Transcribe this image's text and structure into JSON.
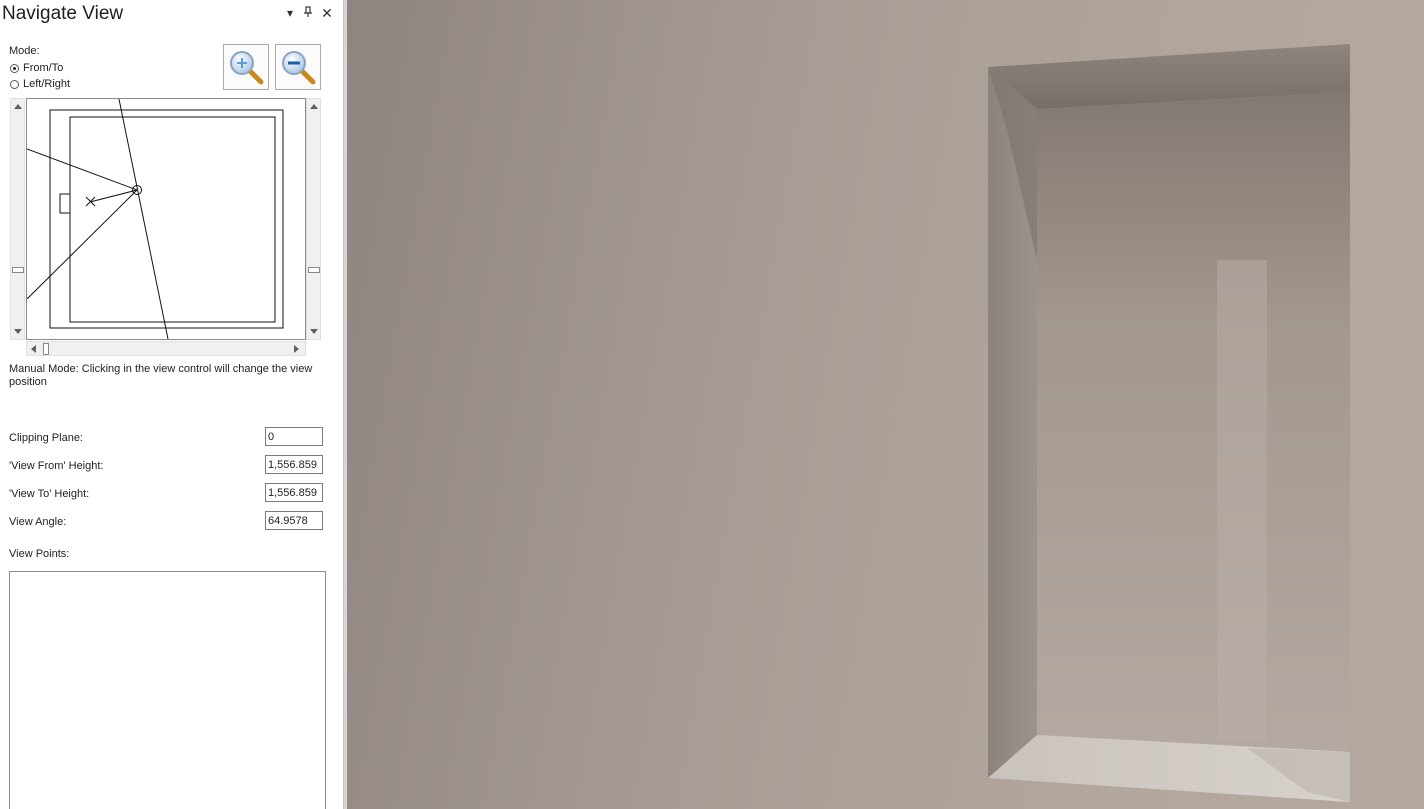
{
  "panel": {
    "title": "Navigate View",
    "title_buttons": {
      "dropdown": "▾",
      "pin": "🖈",
      "close": "✕"
    },
    "mode": {
      "label": "Mode:",
      "options": [
        {
          "label": "From/To",
          "checked": true
        },
        {
          "label": "Left/Right",
          "checked": false
        }
      ]
    },
    "zoom": {
      "in_icon": "zoom-in-icon",
      "out_icon": "zoom-out-icon"
    },
    "manual_mode_text": "Manual Mode: Clicking in the view control will change the view position",
    "fields": {
      "clipping_plane": {
        "label": "Clipping Plane:",
        "value": "0"
      },
      "view_from_height": {
        "label": "'View From' Height:",
        "value": "1,556.859"
      },
      "view_to_height": {
        "label": "'View To' Height:",
        "value": "1,556.859"
      },
      "view_angle": {
        "label": "View Angle:",
        "value": "64.9578"
      }
    },
    "view_points": {
      "label": "View Points:",
      "items": []
    }
  },
  "colors": {
    "wall": "#a89d96",
    "niche_top": "#7f7670",
    "niche_inner": "#b6aaa3",
    "floor": "#d1cbc6"
  }
}
